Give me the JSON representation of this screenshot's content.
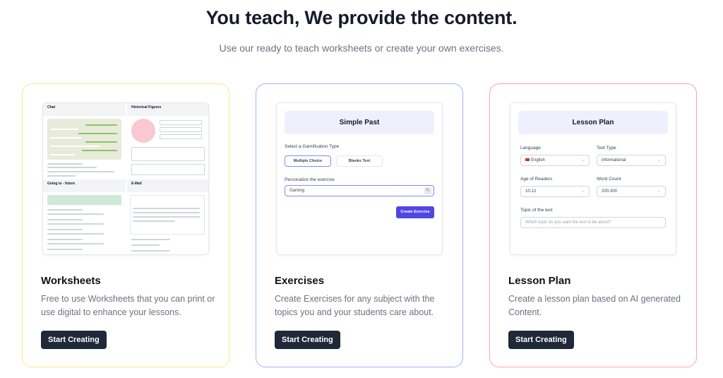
{
  "hero": {
    "title": "You teach, We provide the content.",
    "subtitle": "Use our ready to teach worksheets or create your own exercises."
  },
  "cards": [
    {
      "title": "Worksheets",
      "description": "Free to use Worksheets that you can print or use digital to enhance your lessons.",
      "button": "Start Creating",
      "accent": "#fde68a",
      "preview": {
        "sections": [
          "Chat",
          "Historical Figures",
          "Going to - future",
          "E-Mail"
        ]
      }
    },
    {
      "title": "Exercises",
      "description": "Create Exercises for any subject with the topics you and your students care about.",
      "button": "Start Creating",
      "accent": "#a5b4fc",
      "preview": {
        "heading": "Simple Past",
        "gamification_label": "Select a Gamification Type",
        "options": [
          "Multiple Choice",
          "Blanks Text"
        ],
        "selected_option": "Multiple Choice",
        "personalize_label": "Personalize the exercise",
        "personalize_value": "Gaming",
        "create_button": "Create Exercise"
      }
    },
    {
      "title": "Lesson Plan",
      "description": "Create a lesson plan based on AI generated Content.",
      "button": "Start Creating",
      "accent": "#fca5a5",
      "preview": {
        "heading": "Lesson Plan",
        "language_label": "Language",
        "language_value": "English",
        "text_type_label": "Text Type",
        "text_type_value": "informational",
        "age_label": "Age of Readers",
        "age_value": "10-12",
        "word_count_label": "Word Count",
        "word_count_value": "200-300",
        "topic_label": "Topic of the text",
        "topic_placeholder": "Which topic do you want the text to be about?"
      }
    }
  ]
}
